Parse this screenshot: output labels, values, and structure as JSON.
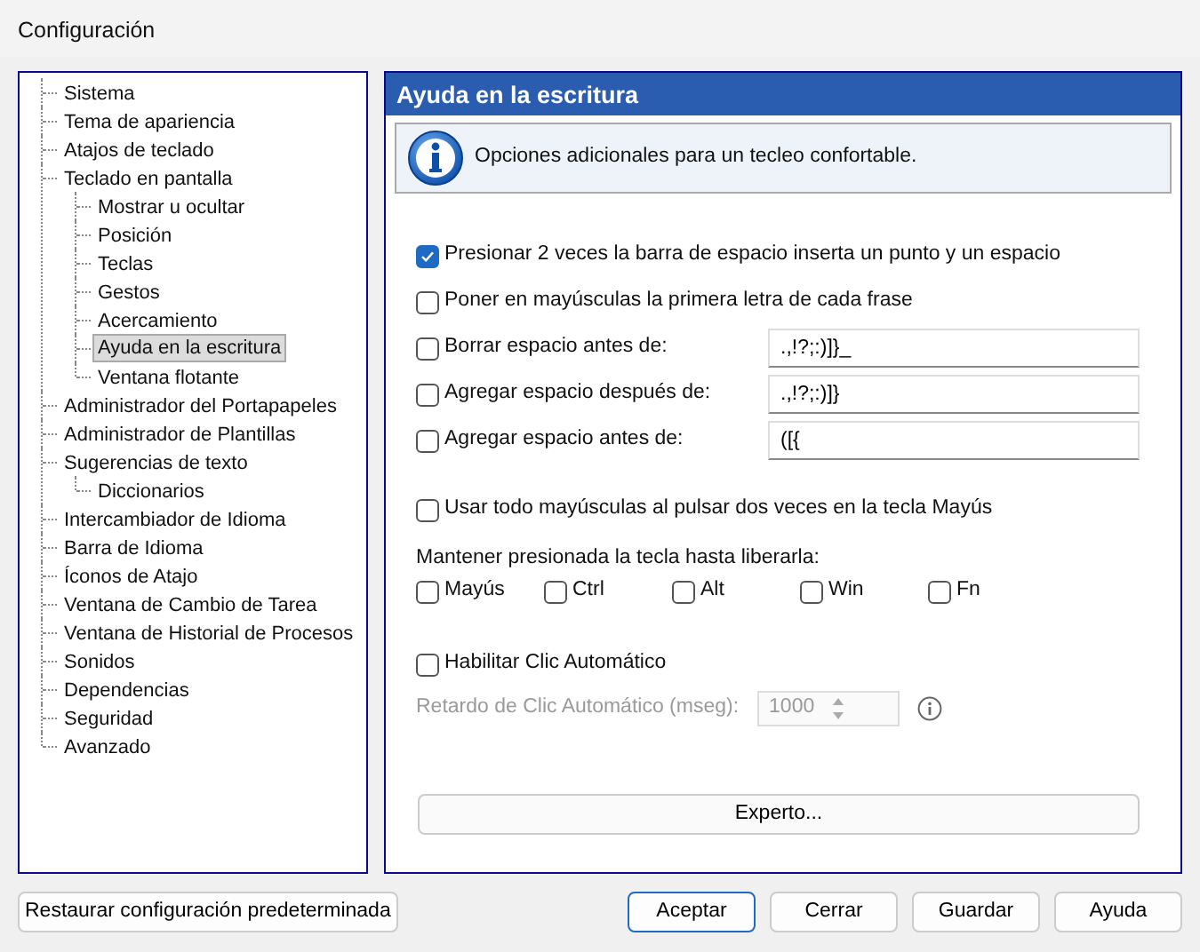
{
  "window": {
    "title": "Configuración"
  },
  "sidebar": {
    "items": [
      {
        "label": "Sistema",
        "selected": false
      },
      {
        "label": "Tema de apariencia",
        "selected": false
      },
      {
        "label": "Atajos de teclado",
        "selected": false
      },
      {
        "label": "Teclado en pantalla",
        "selected": false,
        "children": [
          {
            "label": "Mostrar u ocultar",
            "selected": false
          },
          {
            "label": "Posición",
            "selected": false
          },
          {
            "label": "Teclas",
            "selected": false
          },
          {
            "label": "Gestos",
            "selected": false
          },
          {
            "label": "Acercamiento",
            "selected": false
          },
          {
            "label": "Ayuda en la escritura",
            "selected": true
          },
          {
            "label": "Ventana flotante",
            "selected": false
          }
        ]
      },
      {
        "label": "Administrador del Portapapeles",
        "selected": false
      },
      {
        "label": "Administrador de Plantillas",
        "selected": false
      },
      {
        "label": "Sugerencias de texto",
        "selected": false,
        "children": [
          {
            "label": "Diccionarios",
            "selected": false
          }
        ]
      },
      {
        "label": "Intercambiador de Idioma",
        "selected": false
      },
      {
        "label": "Barra de Idioma",
        "selected": false
      },
      {
        "label": "Íconos de Atajo",
        "selected": false
      },
      {
        "label": "Ventana de Cambio de Tarea",
        "selected": false
      },
      {
        "label": "Ventana de Historial de Procesos",
        "selected": false
      },
      {
        "label": "Sonidos",
        "selected": false
      },
      {
        "label": "Dependencias",
        "selected": false
      },
      {
        "label": "Seguridad",
        "selected": false
      },
      {
        "label": "Avanzado",
        "selected": false
      }
    ]
  },
  "panel": {
    "title": "Ayuda en la escritura",
    "info": "Opciones adicionales para un tecleo confortable.",
    "options": [
      {
        "kind": "checkbox",
        "label": "Presionar 2 veces la barra de espacio inserta un punto y un espacio",
        "checked": true
      },
      {
        "kind": "checkbox",
        "label": "Poner en mayúsculas la primera letra de cada frase",
        "checked": false
      },
      {
        "kind": "field",
        "label": "Borrar espacio antes de:",
        "checked": false,
        "value": ".,!?;:)]}_"
      },
      {
        "kind": "field",
        "label": "Agregar espacio después de:",
        "checked": false,
        "value": ".,!?;:)]}"
      },
      {
        "kind": "field",
        "label": "Agregar espacio antes de:",
        "checked": false,
        "value": "([{"
      },
      {
        "kind": "gap"
      },
      {
        "kind": "checkbox",
        "label": "Usar todo mayúsculas al pulsar dos veces en la tecla Mayús",
        "checked": false
      }
    ],
    "sticky_keys": {
      "label": "Mantener presionada la tecla hasta liberarla:",
      "keys": [
        {
          "label": "Mayús",
          "checked": false
        },
        {
          "label": "Ctrl",
          "checked": false
        },
        {
          "label": "Alt",
          "checked": false
        },
        {
          "label": "Win",
          "checked": false
        },
        {
          "label": "Fn",
          "checked": false
        }
      ]
    },
    "autoclick": {
      "label": "Habilitar Clic Automático",
      "checked": false,
      "delay_label": "Retardo de Clic Automático (mseg):",
      "delay_value": "1000",
      "disabled": true
    },
    "expert_button": "Experto..."
  },
  "footer": {
    "restore_button": "Restaurar configuración predeterminada",
    "buttons": [
      {
        "label": "Aceptar",
        "default": true
      },
      {
        "label": "Cerrar",
        "default": false
      },
      {
        "label": "Guardar",
        "default": false
      },
      {
        "label": "Ayuda",
        "default": false
      }
    ]
  }
}
